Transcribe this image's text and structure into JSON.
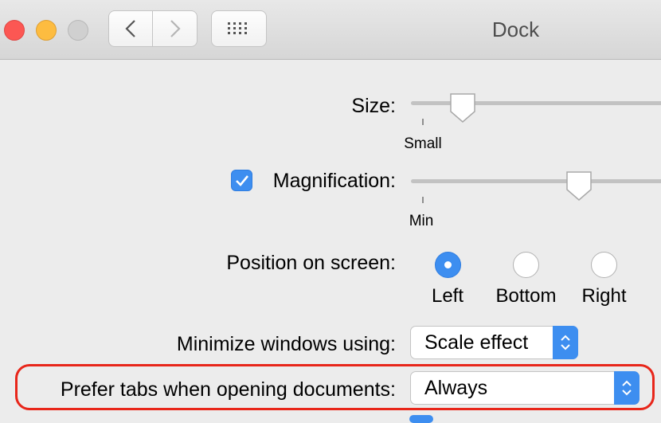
{
  "window": {
    "title": "Dock"
  },
  "toolbar": {
    "back_icon": "chevron-left-icon",
    "forward_icon": "chevron-right-icon",
    "grid_icon": "grid-icon"
  },
  "size": {
    "label": "Size:",
    "min_label": "Small",
    "value_fraction": 0.2
  },
  "magnification": {
    "label": "Magnification:",
    "checked": true,
    "min_label": "Min",
    "value_fraction": 0.68
  },
  "position": {
    "label": "Position on screen:",
    "options": [
      "Left",
      "Bottom",
      "Right"
    ],
    "selected": "Left"
  },
  "minimize": {
    "label": "Minimize windows using:",
    "value": "Scale effect"
  },
  "prefer_tabs": {
    "label": "Prefer tabs when opening documents:",
    "value": "Always"
  },
  "colors": {
    "accent": "#3d8ef0",
    "highlight": "#e8261a"
  }
}
